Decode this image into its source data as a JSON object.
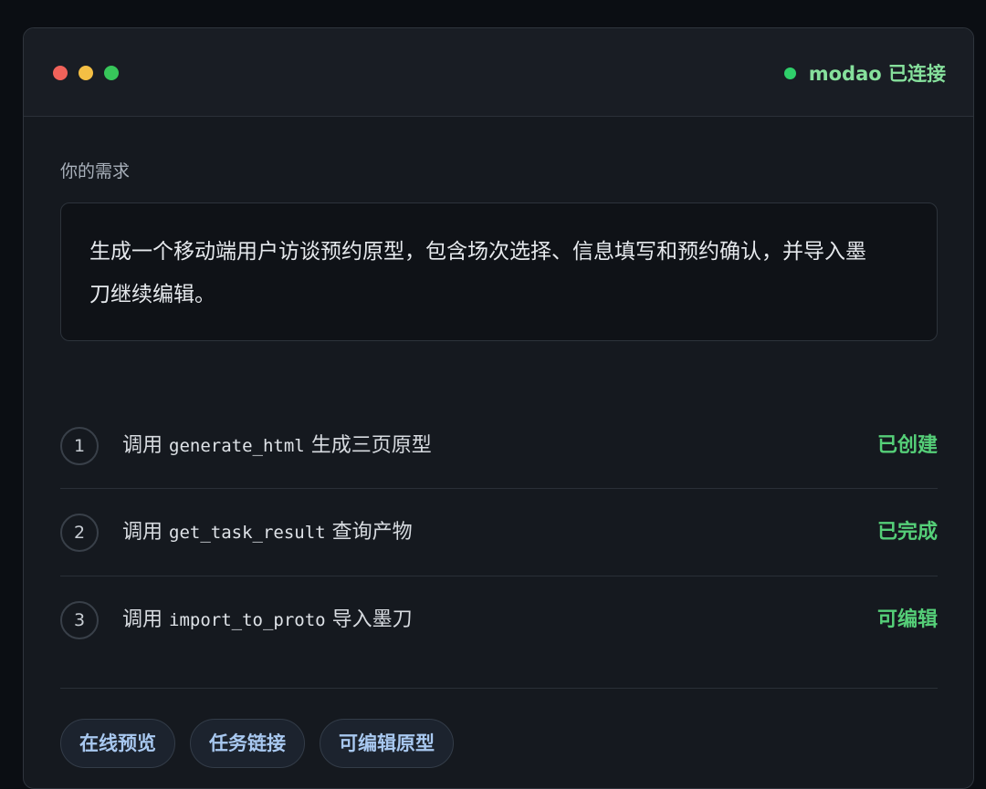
{
  "header": {
    "status_text": "modao 已连接"
  },
  "request": {
    "label": "你的需求",
    "text": "生成一个移动端用户访谈预约原型，包含场次选择、信息填写和预约确认，并导入墨刀继续编辑。"
  },
  "steps": [
    {
      "num": "1",
      "prefix": "调用",
      "code": "generate_html",
      "suffix": "生成三页原型",
      "status": "已创建"
    },
    {
      "num": "2",
      "prefix": "调用",
      "code": "get_task_result",
      "suffix": "查询产物",
      "status": "已完成"
    },
    {
      "num": "3",
      "prefix": "调用",
      "code": "import_to_proto",
      "suffix": "导入墨刀",
      "status": "可编辑"
    }
  ],
  "actions": [
    {
      "label": "在线预览"
    },
    {
      "label": "任务链接"
    },
    {
      "label": "可编辑原型"
    }
  ],
  "colors": {
    "status_green": "#2fcf6a",
    "step_status_green": "#55cf78",
    "button_text": "#a8c8f0"
  }
}
